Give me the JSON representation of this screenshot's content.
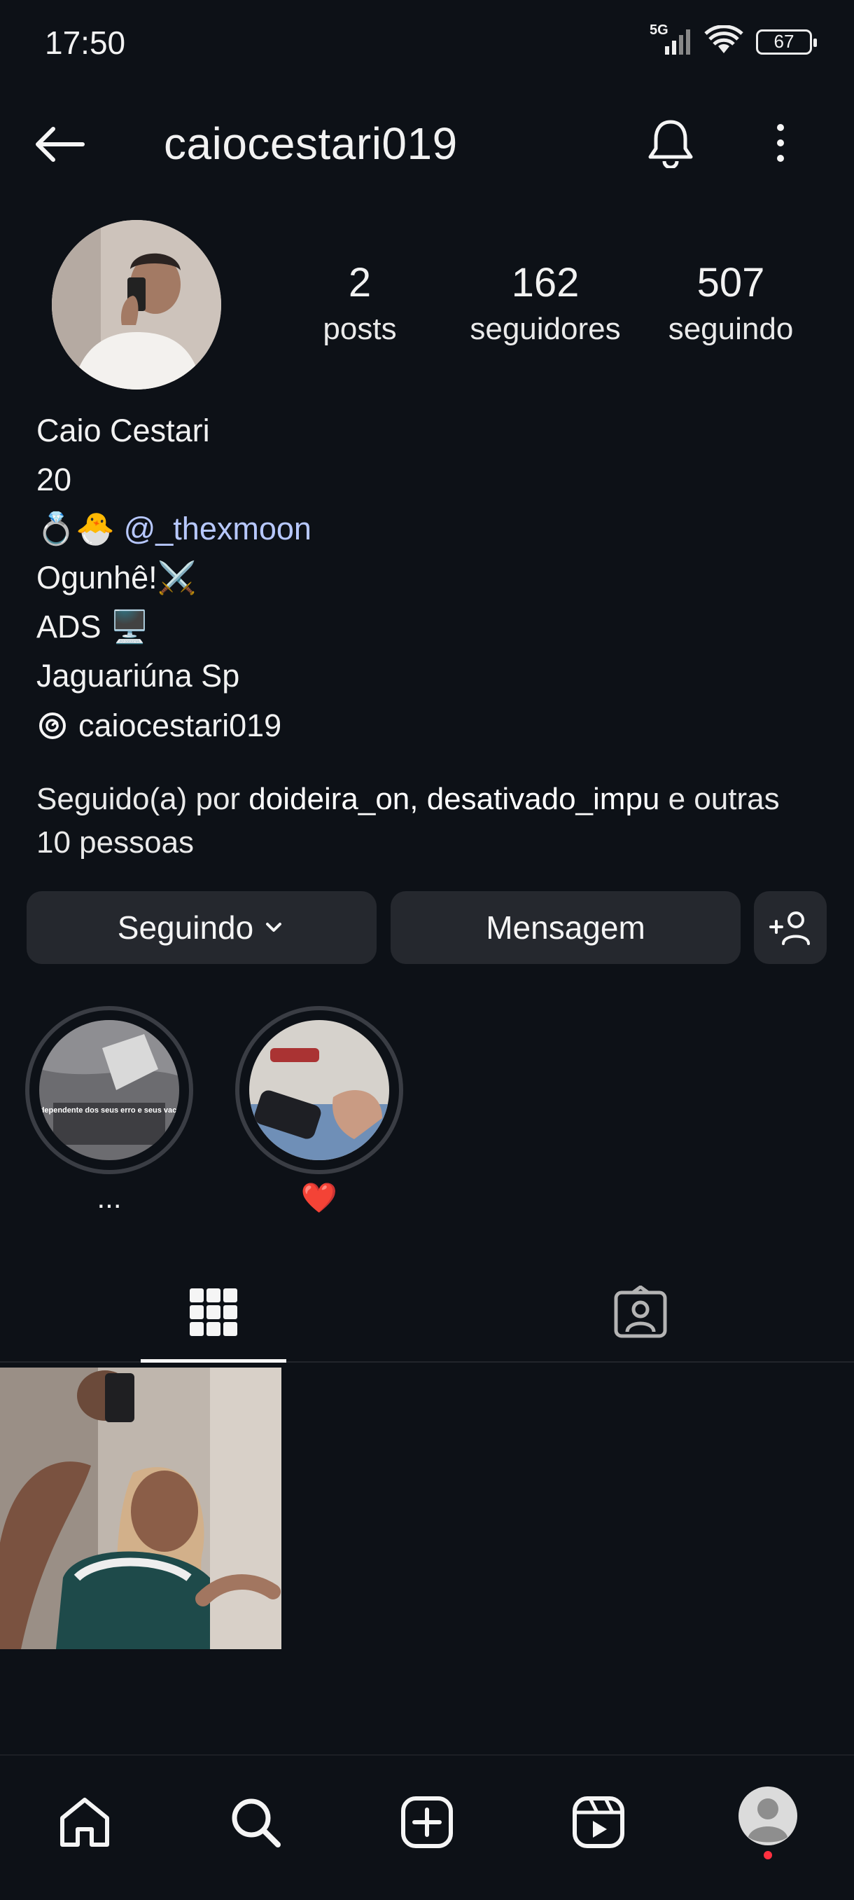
{
  "status_bar": {
    "time": "17:50",
    "network": "5G",
    "battery": "67",
    "icons": [
      "signal-icon",
      "wifi-icon",
      "battery-icon"
    ]
  },
  "header": {
    "username": "caiocestari019",
    "icons": [
      "back-arrow-icon",
      "bell-icon",
      "more-vertical-icon"
    ]
  },
  "profile": {
    "stats": [
      {
        "value": "2",
        "label": "posts"
      },
      {
        "value": "162",
        "label": "seguidores"
      },
      {
        "value": "507",
        "label": "seguindo"
      }
    ],
    "bio": {
      "name": "Caio Cestari",
      "age": "20",
      "line3_emoji": "💍🐣",
      "mention": "@_thexmoon",
      "line4": "Ogunhê!⚔️",
      "line5": "ADS 🖥️",
      "line6": "Jaguariúna Sp"
    },
    "threads_handle": "caiocestari019",
    "followed_by": {
      "prefix": "Seguido(a) por ",
      "names": "doideira_on, desativado_impu",
      "suffix": " e outras 10 pessoas"
    }
  },
  "actions": {
    "following_label": "Seguindo",
    "message_label": "Mensagem"
  },
  "highlights": [
    {
      "label": "...",
      "caption": "Independente dos seus erro e seus vacilo"
    },
    {
      "label": "❤️"
    }
  ],
  "tabs": [
    "grid-icon",
    "tagged-icon"
  ],
  "bottom_nav": [
    "home-icon",
    "search-icon",
    "create-icon",
    "reels-icon",
    "profile-avatar-icon"
  ],
  "colors": {
    "background": "#0d1117",
    "button": "#25282e",
    "mention": "#b7c8ff",
    "notification_dot": "#ff3040"
  }
}
